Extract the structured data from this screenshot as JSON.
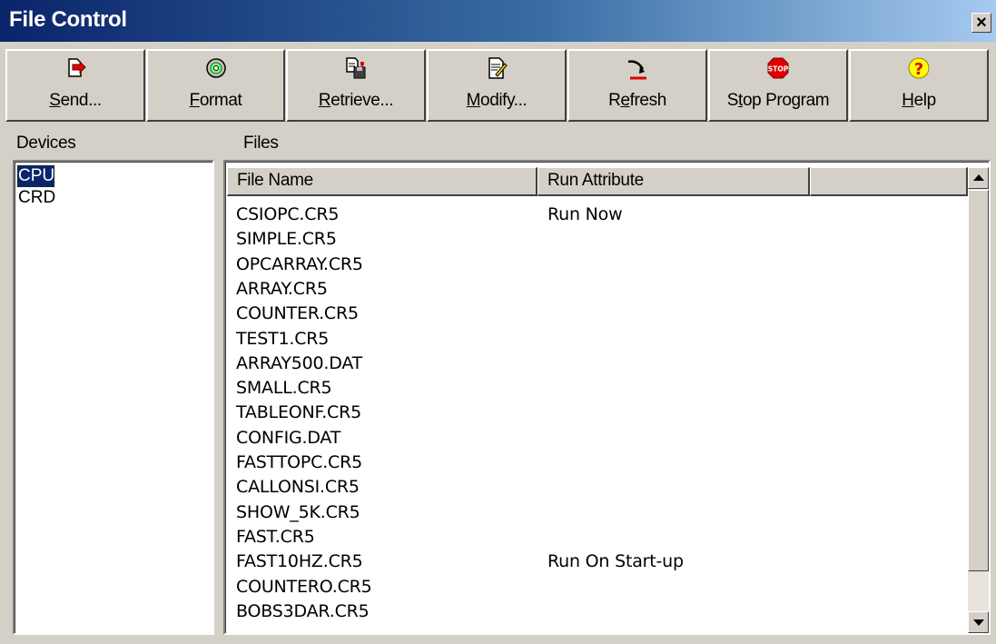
{
  "window": {
    "title": "File Control",
    "close_label": "×"
  },
  "toolbar": {
    "buttons": [
      {
        "label_pre": "",
        "label_key": "S",
        "label_post": "end...",
        "icon": "send-icon"
      },
      {
        "label_pre": "",
        "label_key": "F",
        "label_post": "ormat",
        "icon": "format-disk-icon"
      },
      {
        "label_pre": "",
        "label_key": "R",
        "label_post": "etrieve...",
        "icon": "retrieve-icon"
      },
      {
        "label_pre": "",
        "label_key": "M",
        "label_post": "odify...",
        "icon": "modify-icon"
      },
      {
        "label_pre": "R",
        "label_key": "e",
        "label_post": "fresh",
        "icon": "refresh-icon"
      },
      {
        "label_pre": "S",
        "label_key": "t",
        "label_post": "op Program",
        "icon": "stop-icon"
      },
      {
        "label_pre": "",
        "label_key": "H",
        "label_post": "elp",
        "icon": "help-icon"
      }
    ]
  },
  "devices": {
    "label": "Devices",
    "items": [
      "CPU",
      "CRD"
    ],
    "selected_index": 0
  },
  "files": {
    "label": "Files",
    "columns": [
      "File Name",
      "Run Attribute",
      ""
    ],
    "rows": [
      {
        "name": "CSIOPC.CR5",
        "attr": "Run Now"
      },
      {
        "name": "SIMPLE.CR5",
        "attr": ""
      },
      {
        "name": "OPCARRAY.CR5",
        "attr": ""
      },
      {
        "name": "ARRAY.CR5",
        "attr": ""
      },
      {
        "name": "COUNTER.CR5",
        "attr": ""
      },
      {
        "name": "TEST1.CR5",
        "attr": ""
      },
      {
        "name": "ARRAY500.DAT",
        "attr": ""
      },
      {
        "name": "SMALL.CR5",
        "attr": ""
      },
      {
        "name": "TABLEONF.CR5",
        "attr": ""
      },
      {
        "name": "CONFIG.DAT",
        "attr": ""
      },
      {
        "name": "FASTTOPC.CR5",
        "attr": ""
      },
      {
        "name": "CALLONSI.CR5",
        "attr": ""
      },
      {
        "name": "SHOW_5K.CR5",
        "attr": ""
      },
      {
        "name": "FAST.CR5",
        "attr": ""
      },
      {
        "name": "FAST10HZ.CR5",
        "attr": "Run On Start-up"
      },
      {
        "name": "COUNTERO.CR5",
        "attr": ""
      },
      {
        "name": "BOBS3DAR.CR5",
        "attr": ""
      }
    ]
  },
  "colors": {
    "title_start": "#0a246a",
    "title_end": "#a6caf0",
    "face": "#d4d0c8",
    "selection": "#0a246a",
    "stop_red": "#e00000",
    "help_yellow": "#ffff00"
  }
}
